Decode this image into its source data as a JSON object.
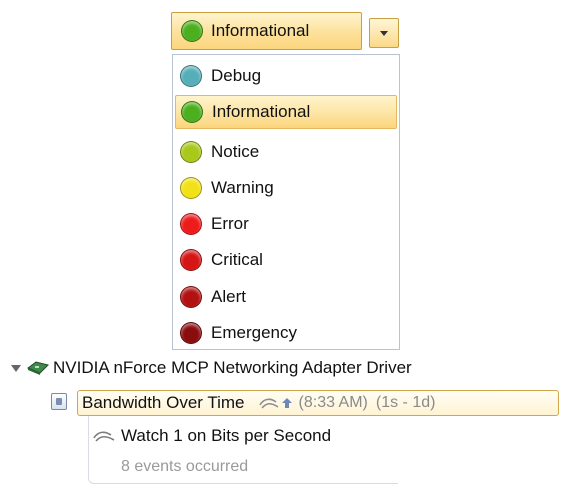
{
  "severity_combo": {
    "selected_label": "Informational",
    "selected_color": "#4caf1e"
  },
  "severity_options": [
    {
      "label": "Debug",
      "color": "#55aeb8",
      "icon": "teal-circle-icon"
    },
    {
      "label": "Informational",
      "color": "#4caf1e",
      "icon": "green-circle-icon",
      "selected": true
    },
    {
      "label": "Notice",
      "color": "#a8c81a",
      "icon": "yellow-green-circle-icon"
    },
    {
      "label": "Warning",
      "color": "#f2e116",
      "icon": "yellow-circle-icon"
    },
    {
      "label": "Error",
      "color": "#ee1b1b",
      "icon": "red-circle-icon"
    },
    {
      "label": "Critical",
      "color": "#d61515",
      "icon": "red-circle-icon"
    },
    {
      "label": "Alert",
      "color": "#b21111",
      "icon": "dark-red-circle-icon"
    },
    {
      "label": "Emergency",
      "color": "#8a0d0d",
      "icon": "maroon-circle-icon"
    }
  ],
  "tree": {
    "adapter_name": "NVIDIA nForce MCP Networking Adapter Driver",
    "rule": {
      "title": "Bandwidth Over Time",
      "time": "(8:33 AM)",
      "range": "(1s - 1d)"
    },
    "watch": {
      "label": "Watch 1 on Bits per Second",
      "events": "8 events occurred"
    }
  }
}
